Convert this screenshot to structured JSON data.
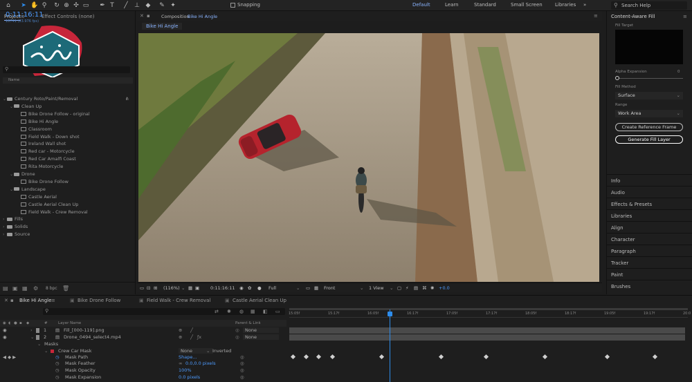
{
  "colors": {
    "accent": "#2d8ceb",
    "link": "#8ab4ff",
    "panel": "#1e1e1e",
    "logo": "#1d6a78",
    "logo_accent": "#c7263a"
  },
  "toolbar": {
    "snapping_label": "Snapping",
    "workspaces": [
      "Default",
      "Learn",
      "Standard",
      "Small Screen",
      "Libraries"
    ],
    "active_workspace": "Default",
    "search_placeholder": "Search Help"
  },
  "project_panel": {
    "tabs": [
      "Project",
      "Effect Controls (none)"
    ],
    "column_header": "Name",
    "tree": [
      {
        "level": 0,
        "type": "folder",
        "label": "Century Roto/Paint/Removal"
      },
      {
        "level": 1,
        "type": "folder",
        "label": "Clean Up"
      },
      {
        "level": 2,
        "type": "file",
        "label": "Bike Drone Follow - original"
      },
      {
        "level": 2,
        "type": "file",
        "label": "Bike Hi Angle"
      },
      {
        "level": 2,
        "type": "file",
        "label": "Classroom"
      },
      {
        "level": 2,
        "type": "file",
        "label": "Field Walk - Down shot"
      },
      {
        "level": 2,
        "type": "file",
        "label": "Ireland Wall shot"
      },
      {
        "level": 2,
        "type": "file",
        "label": "Red car - Motorcycle"
      },
      {
        "level": 2,
        "type": "file",
        "label": "Red Car Amalfi Coast"
      },
      {
        "level": 2,
        "type": "file",
        "label": "Rita Motorcycle"
      },
      {
        "level": 1,
        "type": "folder",
        "label": "Drone"
      },
      {
        "level": 2,
        "type": "file",
        "label": "Bike Drone Follow"
      },
      {
        "level": 1,
        "type": "folder",
        "label": "Landscape"
      },
      {
        "level": 2,
        "type": "file",
        "label": "Castle Aerial"
      },
      {
        "level": 2,
        "type": "file",
        "label": "Castle Aerial Clean Up"
      },
      {
        "level": 2,
        "type": "file",
        "label": "Field Walk - Crew Removal"
      },
      {
        "level": 0,
        "type": "folder",
        "label": "Fills"
      },
      {
        "level": 0,
        "type": "folder",
        "label": "Solids"
      },
      {
        "level": 0,
        "type": "folder",
        "label": "Source"
      }
    ],
    "bpc_label": "8 bpc"
  },
  "composition": {
    "header_label": "Composition",
    "header_name": "Bike Hi Angle",
    "subtab": "Bike Hi Angle",
    "zoom": "(116%)",
    "timecode": "0:11:16:11",
    "resolution": "Full",
    "view": "Front",
    "views": "1 View",
    "exposure": "+0.0"
  },
  "content_aware_fill": {
    "title": "Content-Aware Fill",
    "fill_target_label": "Fill Target",
    "alpha_expansion_label": "Alpha Expansion",
    "alpha_expansion_value": "0",
    "fill_method_label": "Fill Method",
    "fill_method_value": "Surface",
    "range_label": "Range",
    "range_value": "Work Area",
    "create_reference_label": "Create Reference Frame",
    "generate_label": "Generate Fill Layer"
  },
  "right_panels": [
    "Info",
    "Audio",
    "Effects & Presets",
    "Libraries",
    "Align",
    "Character",
    "Paragraph",
    "Tracker",
    "Paint",
    "Brushes"
  ],
  "timeline": {
    "tabs": [
      "Bike Hi Angle",
      "Bike Drone Follow",
      "Field Walk - Crew Removal",
      "Castle Aerial Clean Up"
    ],
    "timecode": "0:11:16:11",
    "timecode_sub": "16741 (23.976 fps)",
    "layer_name_header": "Layer Name",
    "parent_header": "Parent & Link",
    "ruler": [
      "15:05f",
      "15:17f",
      "16:05f",
      "16:17f",
      "17:05f",
      "17:17f",
      "18:05f",
      "18:17f",
      "19:05f",
      "19:17f",
      "20:0"
    ],
    "layers": [
      {
        "num": "1",
        "name": "Fill_[000-119].png",
        "parent": "None"
      },
      {
        "num": "2",
        "name": "Drone_0494_select4.mp4",
        "parent": "None"
      }
    ],
    "masks_label": "Masks",
    "mask_name": "Crew Car Mask",
    "mask_mode": "None",
    "inverted_label": "Inverted",
    "props": [
      {
        "label": "Mask Path",
        "value": "Shape..."
      },
      {
        "label": "Mask Feather",
        "value": "0.0,0.0 pixels"
      },
      {
        "label": "Mask Opacity",
        "value": "100%"
      },
      {
        "label": "Mask Expansion",
        "value": "0.0 pixels"
      }
    ]
  }
}
